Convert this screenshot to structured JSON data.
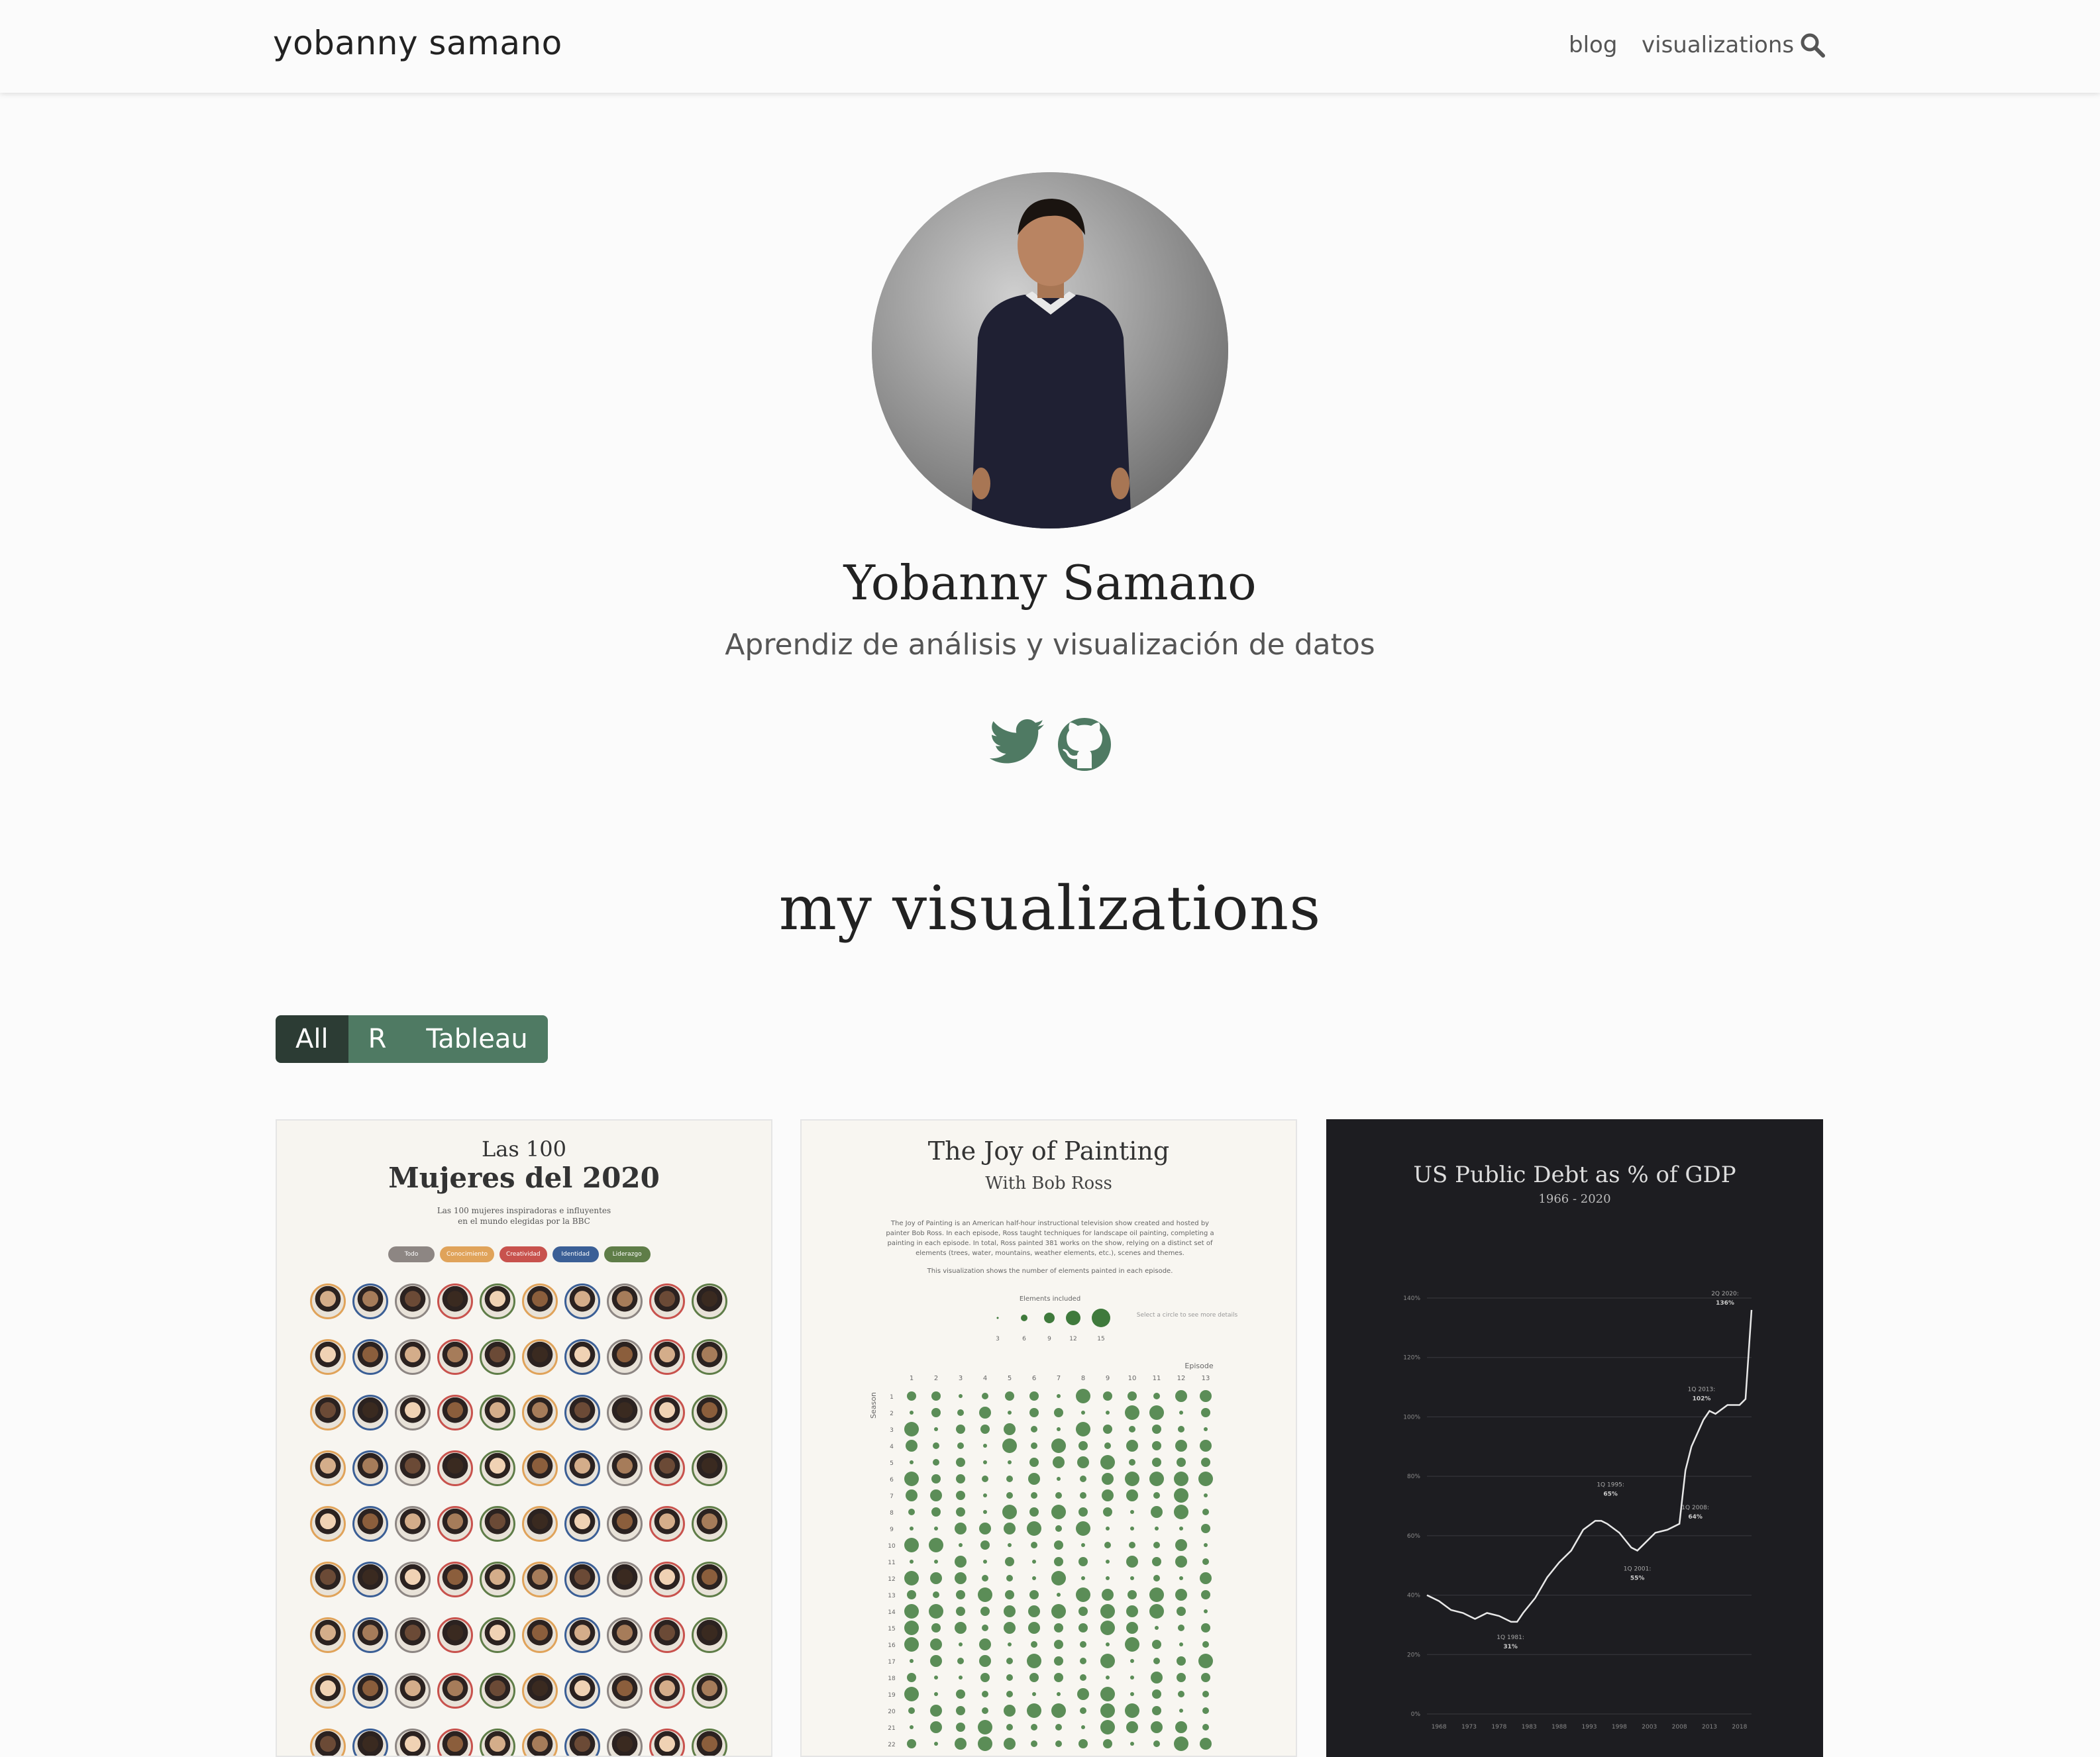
{
  "nav": {
    "brand": "yobanny samano",
    "links": [
      "blog",
      "visualizations"
    ]
  },
  "hero": {
    "name": "Yobanny Samano",
    "subtitle": "Aprendiz de análisis y visualización de datos"
  },
  "section_title": "my visualizations",
  "filters": [
    "All",
    "R",
    "Tableau"
  ],
  "cards": {
    "mujeres": {
      "title_a": "Las 100",
      "title_b": "Mujeres del 2020",
      "subtitle": "Las 100 mujeres inspiradoras e influyentes\nen el mundo elegidas por la BBC",
      "legend": [
        "Todo",
        "Conocimiento",
        "Creatividad",
        "Identidad",
        "Liderazgo"
      ]
    },
    "bobross": {
      "title": "The Joy of Painting",
      "subtitle": "With Bob Ross",
      "text": "The Joy of Painting is an American half-hour instructional television show created and hosted by painter Bob Ross. In each episode, Ross taught techniques for landscape oil painting, completing a painting in each episode. In total, Ross painted 381 works on the show, relying on a distinct set of elements (trees, water, mountains, weather elements, etc.), scenes and themes.",
      "note": "This visualization shows the number of elements painted in each episode.",
      "legend_title": "Elements included",
      "legend_values": [
        3,
        6,
        9,
        12,
        15
      ],
      "legend_hint": "Select a circle to see more details",
      "x_title": "Episode",
      "y_title": "Season"
    },
    "debt": {
      "title": "US Public Debt as % of GDP",
      "subtitle": "1966 - 2020"
    }
  },
  "chart_data": {
    "type": "line",
    "title": "US Public Debt as % of GDP",
    "subtitle": "1966 - 2020",
    "ylim": [
      0,
      140
    ],
    "y_ticks": [
      "0%",
      "20%",
      "40%",
      "60%",
      "80%",
      "100%",
      "120%",
      "140%"
    ],
    "x_ticks": [
      "1968",
      "1973",
      "1978",
      "1983",
      "1988",
      "1993",
      "1998",
      "2003",
      "2008",
      "2013",
      "2018"
    ],
    "x": [
      1966,
      1968,
      1970,
      1972,
      1974,
      1976,
      1978,
      1980,
      1981,
      1982,
      1984,
      1986,
      1988,
      1990,
      1992,
      1994,
      1995,
      1996,
      1998,
      2000,
      2001,
      2002,
      2004,
      2006,
      2008,
      2009,
      2010,
      2012,
      2013,
      2014,
      2016,
      2018,
      2019,
      2020
    ],
    "y": [
      40,
      38,
      35,
      34,
      32,
      34,
      33,
      31,
      31,
      34,
      39,
      46,
      51,
      55,
      62,
      65,
      65,
      64,
      61,
      56,
      55,
      57,
      61,
      62,
      64,
      82,
      90,
      99,
      102,
      101,
      104,
      104,
      106,
      136
    ],
    "annotations": [
      {
        "label": "1Q 1981:",
        "value": "31%"
      },
      {
        "label": "1Q 1995:",
        "value": "65%"
      },
      {
        "label": "1Q 2001:",
        "value": "55%"
      },
      {
        "label": "1Q 2008:",
        "value": "64%"
      },
      {
        "label": "1Q 2013:",
        "value": "102%"
      },
      {
        "label": "2Q 2020:",
        "value": "136%"
      }
    ]
  },
  "colors": {
    "accent": "#4f7a63",
    "accent_dark": "#2c3c34",
    "icon": "#4f7a63"
  }
}
